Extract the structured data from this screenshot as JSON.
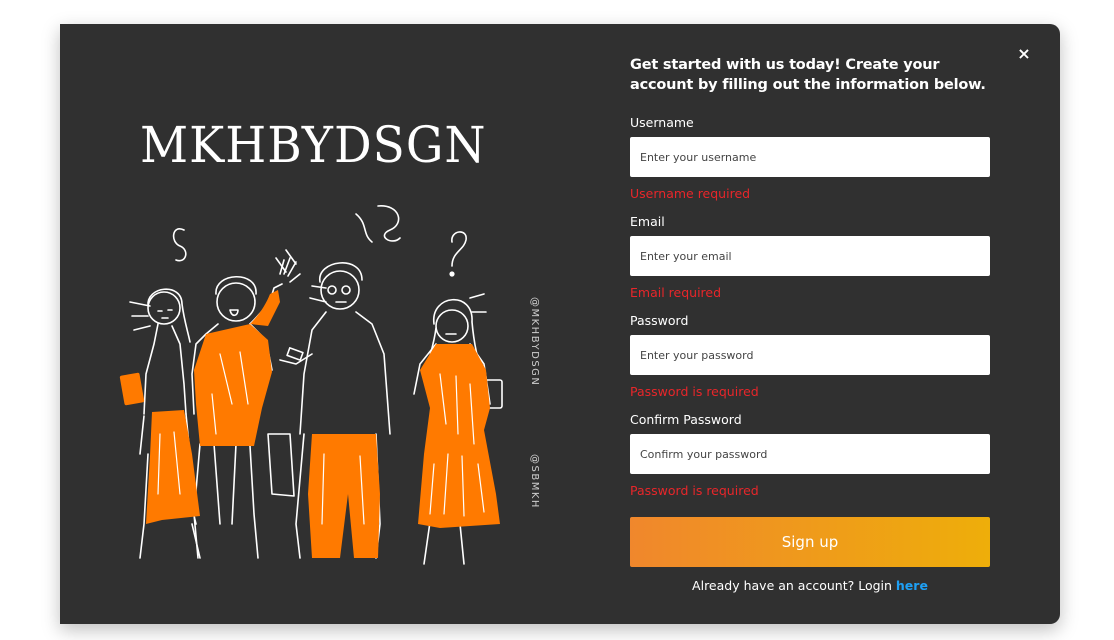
{
  "brand": {
    "logo_text": "MKHBYDSGN"
  },
  "side_credits": {
    "credit_1": "@MKHBYDSGN",
    "credit_2": "@SBMKH"
  },
  "form": {
    "heading": "Get started with us today! Create your account by filling out the information below.",
    "fields": [
      {
        "label": "Username",
        "placeholder": "Enter your username",
        "error": "Username required"
      },
      {
        "label": "Email",
        "placeholder": "Enter your email",
        "error": "Email required"
      },
      {
        "label": "Password",
        "placeholder": "Enter your password",
        "error": "Password is required"
      },
      {
        "label": "Confirm Password",
        "placeholder": "Confirm your password",
        "error": "Password is required"
      }
    ],
    "submit_label": "Sign up",
    "login_prompt": "Already have an account? Login",
    "login_link": "here"
  },
  "close_label": "×",
  "colors": {
    "modal_bg": "#303030",
    "accent_orange": "#ff7a00",
    "error_red": "#e8262a",
    "link_blue": "#1ea0f5",
    "button_gradient_start": "#f0872c",
    "button_gradient_end": "#eeae0a"
  },
  "icons": {
    "close": "close-icon"
  }
}
